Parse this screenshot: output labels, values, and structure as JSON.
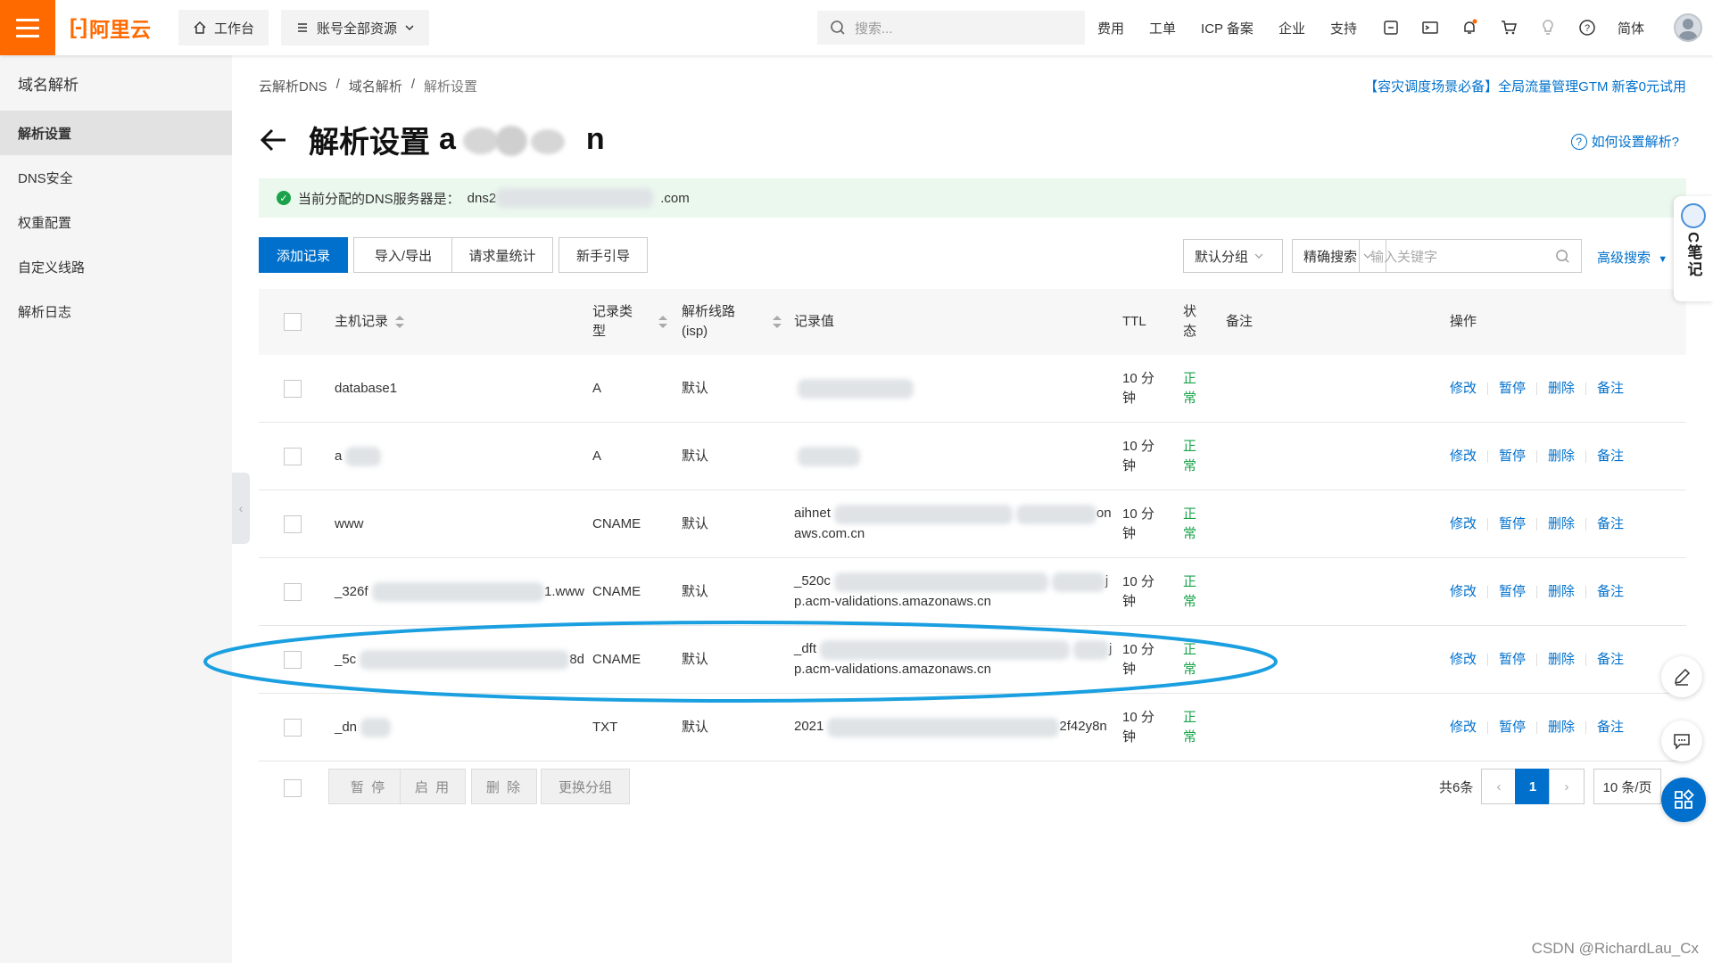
{
  "topbar": {
    "logo_text": "阿里云",
    "workbench": "工作台",
    "resources": "账号全部资源",
    "search_placeholder": "搜索...",
    "links": [
      "费用",
      "工单",
      "ICP 备案",
      "企业",
      "支持"
    ],
    "lang": "简体"
  },
  "sidebar": {
    "title": "域名解析",
    "items": [
      {
        "label": "解析设置",
        "active": true
      },
      {
        "label": "DNS安全"
      },
      {
        "label": "权重配置"
      },
      {
        "label": "自定义线路"
      },
      {
        "label": "解析日志"
      }
    ]
  },
  "breadcrumb": [
    "云解析DNS",
    "域名解析",
    "解析设置"
  ],
  "promo": "【容灾调度场景必备】全局流量管理GTM 新客0元试用",
  "page": {
    "title": "解析设置",
    "domain_visible_start": "a",
    "domain_visible_end": "n",
    "help": "如何设置解析?"
  },
  "notice": {
    "text": "当前分配的DNS服务器是：",
    "server_start": "dns2",
    "server_end": ".com"
  },
  "toolbar": {
    "add": "添加记录",
    "import_export": "导入/导出",
    "stats": "请求量统计",
    "guide": "新手引导",
    "group_select": "默认分组",
    "search_mode": "精确搜索",
    "keyword_placeholder": "输入关键字",
    "advanced": "高级搜索"
  },
  "table": {
    "headers": {
      "host": "主机记录",
      "type": "记录类型",
      "line": "解析线路(isp)",
      "value": "记录值",
      "ttl": "TTL",
      "status": "状态",
      "remark": "备注",
      "ops": "操作"
    },
    "rows": [
      {
        "host": "database1",
        "type": "A",
        "line": "默认",
        "value_a": "",
        "value_b": "",
        "ttl": "10 分钟",
        "status": "正常"
      },
      {
        "host": "a",
        "type": "A",
        "line": "默认",
        "value_a": "",
        "value_b": "",
        "ttl": "10 分钟",
        "status": "正常"
      },
      {
        "host": "www",
        "type": "CNAME",
        "line": "默认",
        "value_a": "aihnet",
        "value_b": "onaws.com.cn",
        "ttl": "10 分钟",
        "status": "正常"
      },
      {
        "host": "_326f",
        "type": "CNAME",
        "line": "默认",
        "value_a": "_520c",
        "value_b": "jp.acm-validations.amazonaws.cn",
        "ttl": "10 分钟",
        "status": "正常"
      },
      {
        "host": "_5c",
        "type": "CNAME",
        "line": "默认",
        "value_a": "_dft",
        "value_b": "jp.acm-validations.amazonaws.cn",
        "ttl": "10 分钟",
        "status": "正常"
      },
      {
        "host": "_dn",
        "type": "TXT",
        "line": "默认",
        "value_a": "2021",
        "value_b": "2f42y8n",
        "ttl": "10 分钟",
        "status": "正常"
      }
    ],
    "row_extras": [
      "",
      "",
      "",
      "1.www",
      "8d",
      ""
    ],
    "ops": [
      "修改",
      "暂停",
      "删除",
      "备注"
    ]
  },
  "footer": {
    "pause": "暂 停",
    "enable": "启 用",
    "delete": "删 除",
    "change_group": "更换分组",
    "total": "共6条",
    "page": "1",
    "page_size": "10 条/页"
  },
  "notes_widget": "C笔记",
  "watermark": "CSDN @RichardLau_Cx",
  "colors": {
    "brand": "#ff6a00",
    "primary": "#0070cc",
    "ok": "#1aa34a",
    "annotation": "#1a9fe0"
  }
}
